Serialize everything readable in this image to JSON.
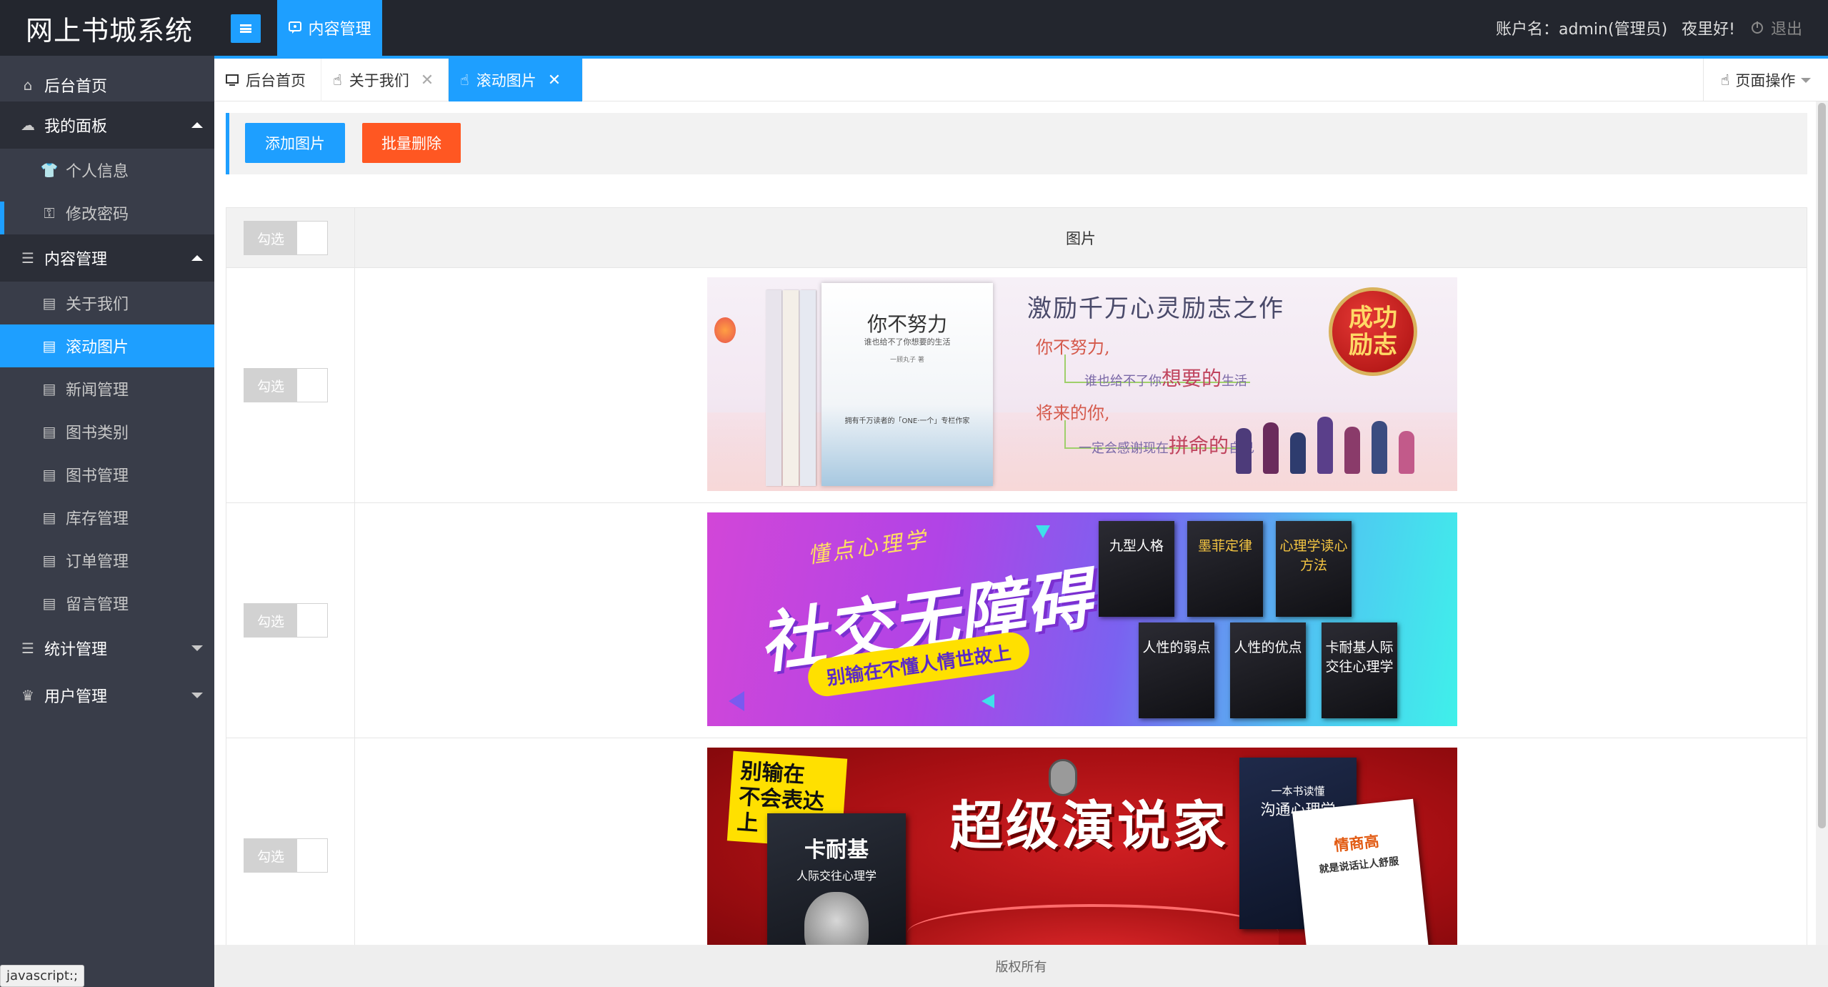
{
  "app": {
    "title": "网上书城系统"
  },
  "header": {
    "top_nav_active": "内容管理",
    "account": "账户名：admin(管理员)",
    "greeting": "夜里好!",
    "logout": "退出"
  },
  "sidebar": {
    "home": "后台首页",
    "groups": [
      {
        "label": "我的面板",
        "expanded": true,
        "items": [
          "个人信息",
          "修改密码"
        ]
      },
      {
        "label": "内容管理",
        "expanded": true,
        "items": [
          "关于我们",
          "滚动图片",
          "新闻管理",
          "图书类别",
          "图书管理",
          "库存管理",
          "订单管理",
          "留言管理"
        ]
      },
      {
        "label": "统计管理",
        "expanded": false,
        "items": []
      },
      {
        "label": "用户管理",
        "expanded": false,
        "items": []
      }
    ],
    "active_item": "滚动图片"
  },
  "tabs": [
    {
      "label": "后台首页",
      "closable": false,
      "active": false
    },
    {
      "label": "关于我们",
      "closable": true,
      "active": false
    },
    {
      "label": "滚动图片",
      "closable": true,
      "active": true
    }
  ],
  "page_ops": "页面操作",
  "toolbar": {
    "add_label": "添加图片",
    "batch_delete_label": "批量删除"
  },
  "table": {
    "checkbox_label": "勾选",
    "column_image": "图片",
    "rows": [
      {
        "banner": {
          "book_title": "你不努力",
          "book_subtitle": "谁也给不了你想要的生活",
          "book_author": "一顾丸子 著",
          "book_blurb": "拥有千万读者的「ONE·一个」专栏作家",
          "headline": "激励千万心灵励志之作",
          "seal_line1": "成功",
          "seal_line2": "励志",
          "line1": "你不努力,",
          "line2_a": "谁也给不了你",
          "line2_b": "想要的",
          "line2_c": "生活",
          "line3": "将来的你,",
          "line4_a": "一定会感谢现在",
          "line4_b": "拼命的",
          "line4_c": "自己"
        }
      },
      {
        "banner": {
          "sub": "懂点心理学",
          "title": "社交无障碍",
          "pill": "别输在不懂人情世故上",
          "books": [
            "九型人格",
            "墨菲定律",
            "心理学读心方法",
            "人性的弱点",
            "人性的优点",
            "卡耐基人际交往心理学"
          ]
        }
      },
      {
        "banner": {
          "yellow_line1": "别输在",
          "yellow_line2": "不会表达上",
          "book_left_title": "卡耐基",
          "book_left_sub": "人际交往心理学",
          "title": "超级演说家",
          "book_right_title": "沟通心理学",
          "book_right_sub": "一本书读懂",
          "book_white_title": "情商高",
          "book_white_sub": "就是说话让人舒服"
        }
      }
    ]
  },
  "footer": "版权所有",
  "status_tip": "javascript:;",
  "colors": {
    "accent": "#1e9fff",
    "danger": "#ff5722",
    "header_bg": "#23262e",
    "sidebar_bg": "#393d49"
  }
}
